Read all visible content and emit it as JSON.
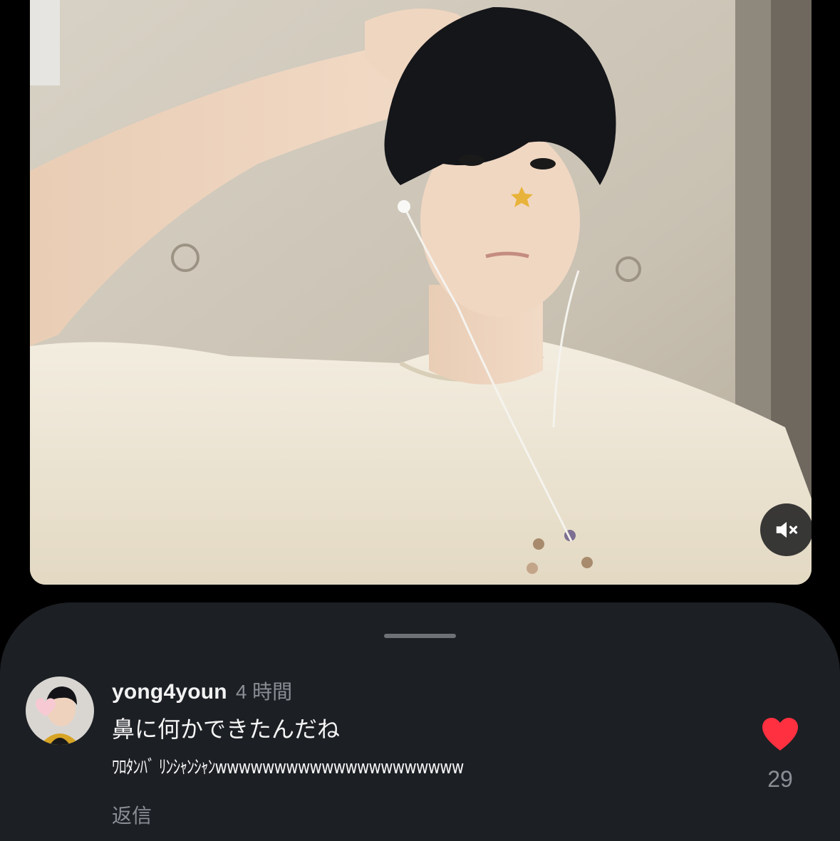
{
  "video": {
    "mute_icon": "speaker-muted-icon"
  },
  "comment": {
    "username": "yong4youn",
    "time_ago": "4 時間",
    "line1": "鼻に何かできたんだね",
    "line2": "ﾜﾛﾀﾝﾊﾞ ﾘﾝｼｬﾝｼｬﾝwwwwwwwwwwwwwwwwwwwww",
    "reply_label": "返信",
    "like_count": "29",
    "liked": true
  },
  "colors": {
    "background": "#000000",
    "sheet": "#1c1f24",
    "like": "#ff3040",
    "muted_text": "#8b8f95"
  }
}
